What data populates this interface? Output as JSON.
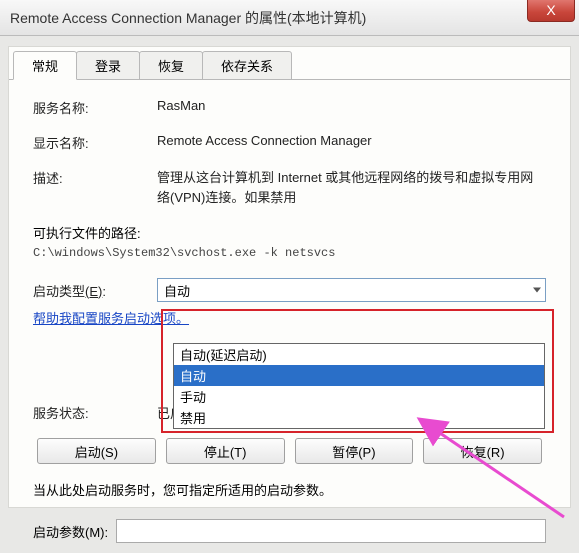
{
  "title_bar": {
    "title": "Remote Access Connection Manager 的属性(本地计算机)",
    "close": "X"
  },
  "tabs": [
    {
      "label": "常规"
    },
    {
      "label": "登录"
    },
    {
      "label": "恢复"
    },
    {
      "label": "依存关系"
    }
  ],
  "fields": {
    "service_name_label": "服务名称:",
    "service_name_value": "RasMan",
    "display_name_label": "显示名称:",
    "display_name_value": "Remote Access Connection Manager",
    "description_label": "描述:",
    "description_value": "管理从这台计算机到 Internet 或其他远程网络的拨号和虚拟专用网络(VPN)连接。如果禁用",
    "exec_path_label": "可执行文件的路径:",
    "exec_path_value": "C:\\windows\\System32\\svchost.exe -k netsvcs",
    "startup_type_label": "启动类型",
    "startup_type_hotkey": "(E)",
    "startup_type_colon": ":",
    "startup_selected": "自动",
    "help_link": "帮助我配置服务启动选项。",
    "service_status_label": "服务状态:",
    "service_status_value": "已启动",
    "hint_text": "当从此处启动服务时，您可指定所适用的启动参数。",
    "params_label": "启动参数(M):"
  },
  "dropdown_options": [
    "自动(延迟启动)",
    "自动",
    "手动",
    "禁用"
  ],
  "buttons": {
    "start": "启动(S)",
    "stop": "停止(T)",
    "pause": "暂停(P)",
    "resume": "恢复(R)"
  }
}
